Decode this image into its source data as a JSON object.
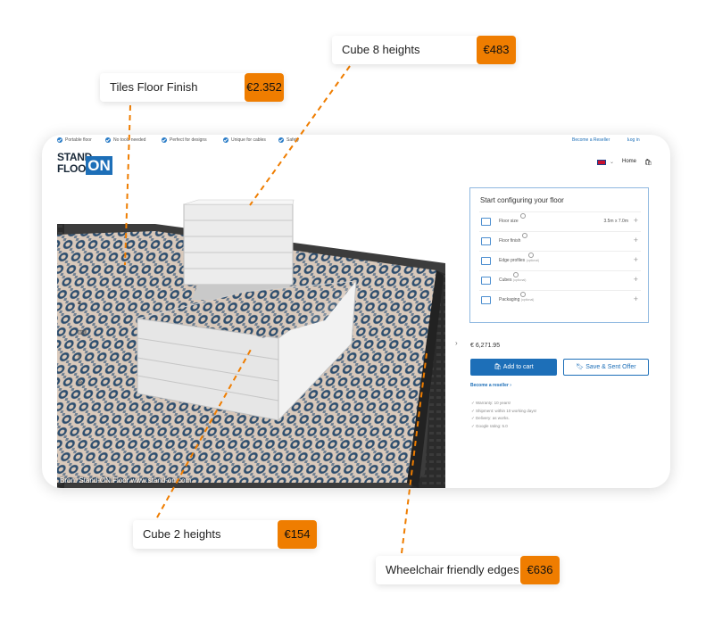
{
  "topbar": {
    "features": [
      "Portable floor",
      "No tools needed",
      "Perfect for designs",
      "Unique for cables",
      "Safety"
    ],
    "become_reseller": "Become a Reseller",
    "login": "Log in"
  },
  "header": {
    "logo_line1": "STAND",
    "logo_line2": "FLOOR",
    "logo_on": "ON",
    "home": "Home"
  },
  "scene": {
    "credit": "Bron: Stand-ON Floor www.stand-on.com",
    "tile_colors": [
      "#2e4e6e",
      "#d9c9bb",
      "#6d7f92"
    ]
  },
  "configurator": {
    "title": "Start configuring your floor",
    "rows": [
      {
        "label": "Floor size",
        "optional": "",
        "value": "3.5m x 7.0m",
        "icon": "floor-size-icon"
      },
      {
        "label": "Floor finish",
        "optional": "",
        "value": "",
        "icon": "paint-roller-icon"
      },
      {
        "label": "Edge profiles",
        "optional": "(optional)",
        "value": "",
        "icon": "edge-profile-icon"
      },
      {
        "label": "Cubes",
        "optional": "(optional)",
        "value": "",
        "icon": "cube-icon"
      },
      {
        "label": "Packaging",
        "optional": "(optional)",
        "value": "",
        "icon": "package-icon"
      }
    ],
    "price": "€ 6,271.95",
    "add_to_cart": "Add to cart",
    "save_offer": "Save & Sent Offer",
    "become_reseller": "Become a reseller",
    "perks": [
      "Warranty: 10 years!",
      "Shipment: within 10 working days!",
      "Delivery: as works.",
      "Google rating: 5.0"
    ]
  },
  "callouts": [
    {
      "name": "Tiles Floor Finish",
      "price": "€2.352"
    },
    {
      "name": "Cube 8 heights",
      "price": "€483"
    },
    {
      "name": "Cube 2 heights",
      "price": "€154"
    },
    {
      "name": "Wheelchair friendly edges",
      "price": "€636"
    }
  ],
  "colors": {
    "accent": "#1d6fb8",
    "callout": "#ef7d00"
  }
}
